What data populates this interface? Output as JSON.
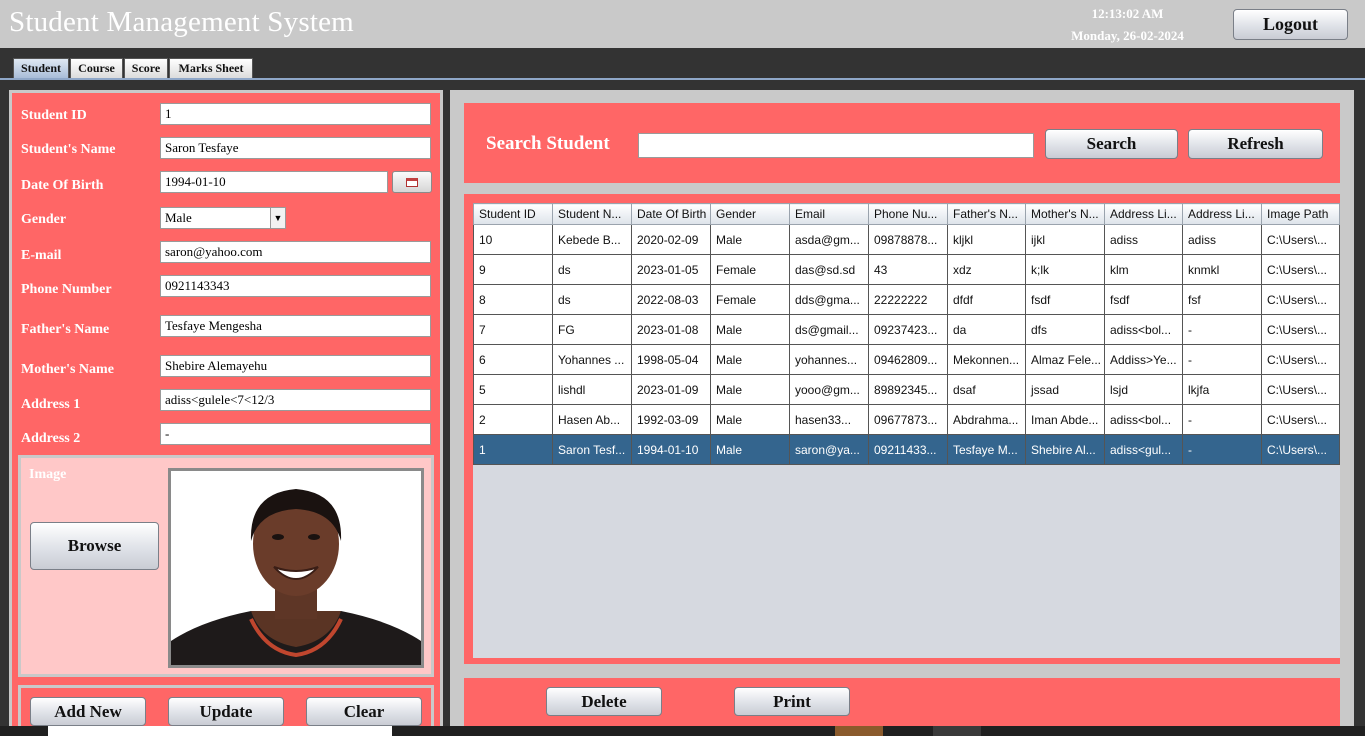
{
  "app": {
    "title": "Student Management System"
  },
  "clock": {
    "time": "12:13:02 AM",
    "date": "Monday, 26-02-2024"
  },
  "logout_label": "Logout",
  "tabs": [
    {
      "label": "Student",
      "active": true
    },
    {
      "label": "Course",
      "active": false
    },
    {
      "label": "Score",
      "active": false
    },
    {
      "label": "Marks Sheet",
      "active": false
    }
  ],
  "form": {
    "student_id": {
      "label": "Student ID",
      "value": "1"
    },
    "name": {
      "label": "Student's Name",
      "value": "Saron Tesfaye"
    },
    "dob": {
      "label": "Date Of Birth",
      "value": "1994-01-10"
    },
    "gender": {
      "label": "Gender",
      "value": "Male"
    },
    "email": {
      "label": "E-mail",
      "value": "saron@yahoo.com"
    },
    "phone": {
      "label": "Phone Number",
      "value": "0921143343"
    },
    "father": {
      "label": "Father's Name",
      "value": "Tesfaye Mengesha"
    },
    "mother": {
      "label": "Mother's Name",
      "value": "Shebire Alemayehu"
    },
    "address1": {
      "label": "Address 1",
      "value": "adiss<gulele<7<12/3"
    },
    "address2": {
      "label": "Address 2",
      "value": "-"
    }
  },
  "image_section": {
    "label": "Image",
    "browse_label": "Browse"
  },
  "left_actions": {
    "add_new": "Add New",
    "update": "Update",
    "clear": "Clear"
  },
  "search": {
    "label": "Search Student",
    "value": "",
    "search_label": "Search",
    "refresh_label": "Refresh"
  },
  "table": {
    "columns": [
      "Student ID",
      "Student N...",
      "Date Of Birth",
      "Gender",
      "Email",
      "Phone Nu...",
      "Father's N...",
      "Mother's N...",
      "Address Li...",
      "Address Li...",
      "Image Path"
    ],
    "rows": [
      [
        "10",
        "Kebede B...",
        "2020-02-09",
        "Male",
        "asda@gm...",
        "09878878...",
        "kljkl",
        "ijkl",
        "adiss",
        "adiss",
        "C:\\Users\\..."
      ],
      [
        "9",
        "ds",
        "2023-01-05",
        "Female",
        "das@sd.sd",
        "43",
        "xdz",
        "k;lk",
        "klm",
        "knmkl",
        "C:\\Users\\..."
      ],
      [
        "8",
        "ds",
        "2022-08-03",
        "Female",
        "dds@gma...",
        "22222222",
        "dfdf",
        "fsdf",
        "fsdf",
        "fsf",
        "C:\\Users\\..."
      ],
      [
        "7",
        "FG",
        "2023-01-08",
        "Male",
        "ds@gmail...",
        "09237423...",
        "da",
        "dfs",
        "adiss<bol...",
        "-",
        "C:\\Users\\..."
      ],
      [
        "6",
        "Yohannes ...",
        "1998-05-04",
        "Male",
        "yohannes...",
        "09462809...",
        "Mekonnen...",
        "Almaz Fele...",
        "Addiss>Ye...",
        "-",
        "C:\\Users\\..."
      ],
      [
        "5",
        "lishdl",
        "2023-01-09",
        "Male",
        "yooo@gm...",
        "89892345...",
        "dsaf",
        "jssad",
        "lsjd",
        "lkjfa",
        "C:\\Users\\..."
      ],
      [
        "2",
        "Hasen Ab...",
        "1992-03-09",
        "Male",
        "hasen33...",
        "09677873...",
        "Abdrahma...",
        "Iman Abde...",
        "adiss<bol...",
        "-",
        "C:\\Users\\..."
      ],
      [
        "1",
        "Saron Tesf...",
        "1994-01-10",
        "Male",
        "saron@ya...",
        "09211433...",
        "Tesfaye M...",
        "Shebire Al...",
        "adiss<gul...",
        "-",
        "C:\\Users\\..."
      ]
    ],
    "selected_row": 7
  },
  "right_actions": {
    "delete": "Delete",
    "print": "Print"
  },
  "colors": {
    "panel": "#ff6666",
    "selection": "#34658e",
    "frame": "#c9c9c9"
  }
}
